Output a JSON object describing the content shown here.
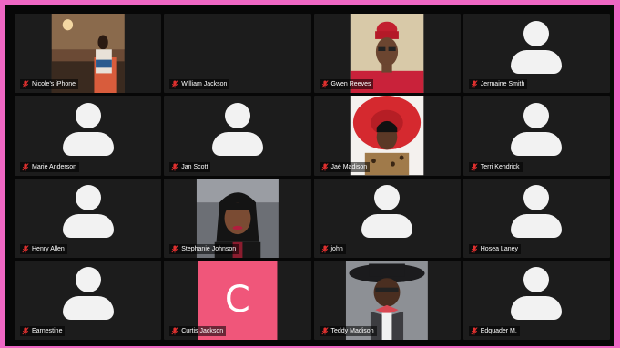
{
  "participants": [
    {
      "name": "Nicole's iPhone",
      "video": "photo-man-standing",
      "muted": true
    },
    {
      "name": "William Jackson",
      "video": "off",
      "muted": true
    },
    {
      "name": "Gwen Reeves",
      "video": "photo-woman-red-headwrap",
      "muted": true
    },
    {
      "name": "Jermaine Smith",
      "video": "avatar",
      "muted": true
    },
    {
      "name": "Marie Anderson",
      "video": "avatar",
      "muted": true
    },
    {
      "name": "Jan Scott",
      "video": "avatar",
      "muted": true
    },
    {
      "name": "Jaé Madison",
      "video": "photo-woman-red-hat",
      "muted": true
    },
    {
      "name": "Terri Kendrick",
      "video": "avatar",
      "muted": true
    },
    {
      "name": "Henry Allen",
      "video": "avatar",
      "muted": true
    },
    {
      "name": "Stephanie Johnson",
      "video": "photo-woman-car",
      "muted": true
    },
    {
      "name": "john",
      "video": "avatar",
      "muted": true
    },
    {
      "name": "Hosea Laney",
      "video": "avatar",
      "muted": true
    },
    {
      "name": "Earnestine",
      "video": "avatar",
      "muted": true
    },
    {
      "name": "Curtis Jackson",
      "video": "letter",
      "letter": "C",
      "letter_bg": "#f0567a",
      "muted": true
    },
    {
      "name": "Teddy Madison",
      "video": "photo-man-hat",
      "muted": true
    },
    {
      "name": "Edquader M.",
      "video": "avatar",
      "muted": true
    }
  ],
  "colors": {
    "frame": "#ee67c4",
    "tile_bg": "#1c1c1c",
    "mute_icon": "#e0302f"
  },
  "icons": {
    "mute": "microphone-muted-icon",
    "avatar": "person-silhouette-icon"
  }
}
